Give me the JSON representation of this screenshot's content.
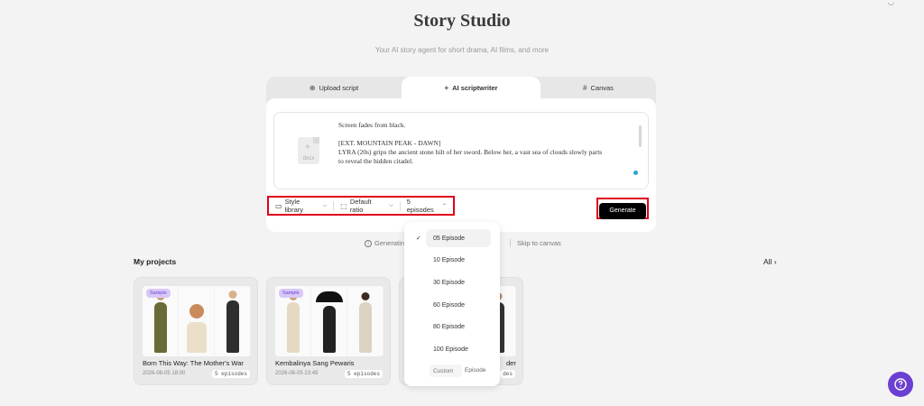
{
  "header": {
    "title": "Story Studio",
    "subtitle": "Your AI story agent for short drama, AI films, and more"
  },
  "tabs": [
    {
      "label": "Upload script",
      "icon": "upload-icon"
    },
    {
      "label": "AI scriptwriter",
      "icon": "plus-icon"
    },
    {
      "label": "Canvas",
      "icon": "hash-icon"
    }
  ],
  "editor": {
    "docx_label": "docx",
    "lines": [
      "Screen fades from black.",
      "",
      "[EXT. MOUNTAIN PEAK - DAWN]",
      "LYRA (20s) grips the ancient stone hilt of her sword. Below her, a vast sea of clouds slowly parts",
      "to reveal the hidden citadel."
    ]
  },
  "toolbar": {
    "style_label": "Style library",
    "ratio_label": "Default ratio",
    "episodes_label": "5 episodes",
    "generate_label": "Generate"
  },
  "status": {
    "generating": "Generating",
    "skip": "Skip to canvas"
  },
  "projects": {
    "title": "My projects",
    "all_label": "All",
    "items": [
      {
        "sample": "Sample",
        "name": "Born This Way: The Mother's War",
        "date": "2026-08-05 18:00",
        "episodes": "5 episodes"
      },
      {
        "sample": "Sample",
        "name": "Kembalinya Sang Pewaris",
        "date": "2026-08-05 23:49",
        "episodes": "5 episodes"
      },
      {
        "sample": "",
        "name": "der",
        "date": "",
        "episodes": "des"
      }
    ]
  },
  "dropdown": {
    "options": [
      "05 Episode",
      "10 Episode",
      "30 Episode",
      "60 Episode",
      "80 Episode",
      "100 Episode"
    ],
    "selected": "05 Episode",
    "custom_placeholder": "Custom",
    "custom_unit": "Episode"
  },
  "colors": {
    "accent": "#6a3fd1",
    "highlight": "#e0001a",
    "primary_button": "#000000"
  }
}
